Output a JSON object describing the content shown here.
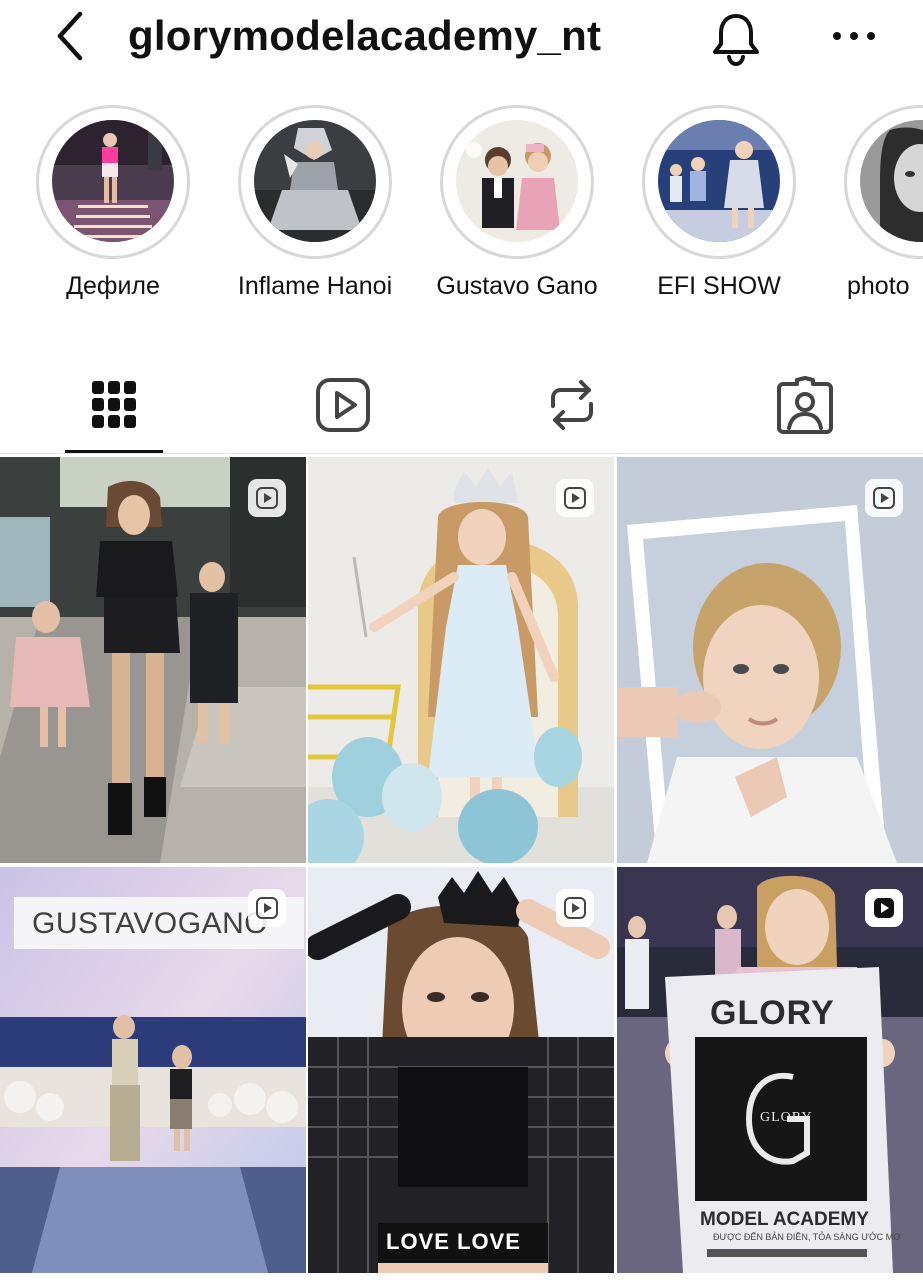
{
  "header": {
    "username": "glorymodelacademy_nt",
    "icons": [
      "back-arrow-icon",
      "bell-icon",
      "more-dots-icon"
    ]
  },
  "highlights": [
    {
      "label": "Дефиле"
    },
    {
      "label": "Inflame Hanoi"
    },
    {
      "label": "Gustavo Gano"
    },
    {
      "label": "EFI SHOW"
    },
    {
      "label": "photo"
    }
  ],
  "tabs": [
    {
      "name": "grid",
      "icon": "grid-icon",
      "active": true
    },
    {
      "name": "reels",
      "icon": "reels-icon",
      "active": false
    },
    {
      "name": "reposts",
      "icon": "repost-icon",
      "active": false
    },
    {
      "name": "tagged",
      "icon": "tagged-icon",
      "active": false
    }
  ],
  "posts": [
    {
      "type": "reel"
    },
    {
      "type": "reel"
    },
    {
      "type": "reel"
    },
    {
      "type": "reel",
      "overlay_text": "GUSTAVOGANO"
    },
    {
      "type": "reel",
      "overlay_text": "LOVE LOVE"
    },
    {
      "type": "reel",
      "sign_title": "GLORY",
      "sign_logo": "GLORY",
      "sign_subtitle": "MODEL ACADEMY",
      "sign_tagline": "ĐƯỢC ĐẾN BẢN ĐIỀN, TỎA SÁNG ƯỚC MƠ"
    }
  ],
  "colors": {
    "text": "#111111",
    "ring": "#d7d7d7",
    "underline": "#111111"
  }
}
